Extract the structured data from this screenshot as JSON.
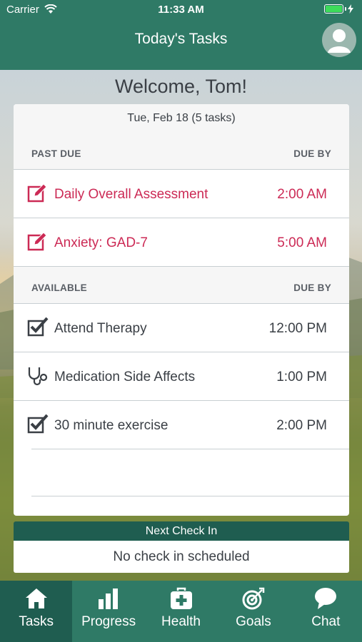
{
  "status_bar": {
    "carrier": "Carrier",
    "time": "11:33 AM"
  },
  "header": {
    "title": "Today's Tasks"
  },
  "welcome": "Welcome, Tom!",
  "card": {
    "date": "Tue, Feb 18 (5 tasks)",
    "past_due": {
      "label": "PAST DUE",
      "due_label": "DUE BY",
      "tasks": [
        {
          "name": "Daily Overall Assessment",
          "time": "2:00 AM",
          "icon": "edit-icon"
        },
        {
          "name": "Anxiety: GAD-7",
          "time": "5:00 AM",
          "icon": "edit-icon"
        }
      ]
    },
    "available": {
      "label": "AVAILABLE",
      "due_label": "DUE BY",
      "tasks": [
        {
          "name": "Attend Therapy",
          "time": "12:00 PM",
          "icon": "checkbox-icon"
        },
        {
          "name": "Medication Side Affects",
          "time": "1:00 PM",
          "icon": "stethoscope-icon"
        },
        {
          "name": "30 minute exercise",
          "time": "2:00 PM",
          "icon": "checkbox-icon"
        }
      ]
    }
  },
  "checkin": {
    "title": "Next Check In",
    "message": "No check in scheduled"
  },
  "tabs": [
    {
      "label": "Tasks",
      "icon": "home-icon",
      "active": true
    },
    {
      "label": "Progress",
      "icon": "bar-chart-icon",
      "active": false
    },
    {
      "label": "Health",
      "icon": "medical-kit-icon",
      "active": false
    },
    {
      "label": "Goals",
      "icon": "target-icon",
      "active": false
    },
    {
      "label": "Chat",
      "icon": "chat-bubble-icon",
      "active": false
    }
  ],
  "colors": {
    "primary": "#2f7a66",
    "primary_dark": "#1f5d50",
    "past_due": "#cc2a55",
    "text": "#3a3f45"
  }
}
